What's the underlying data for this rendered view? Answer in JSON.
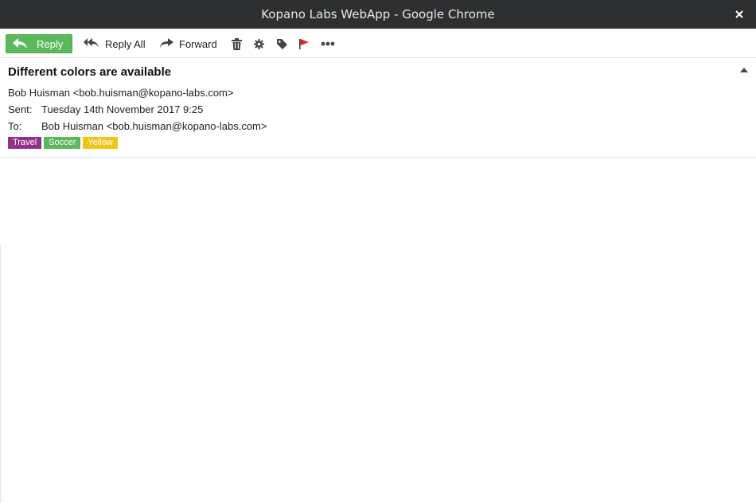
{
  "window": {
    "title": "Kopano Labs WebApp - Google Chrome"
  },
  "toolbar": {
    "reply": "Reply",
    "reply_all": "Reply All",
    "forward": "Forward",
    "icons": [
      "reply-icon",
      "reply-all-icon",
      "forward-icon",
      "trash-icon",
      "gear-icon",
      "tag-icon",
      "flag-icon",
      "more-icon"
    ]
  },
  "message": {
    "subject": "Different colors are available",
    "from": "Bob Huisman <bob.huisman@kopano-labs.com>",
    "sent_label": "Sent:",
    "sent": "Tuesday 14th November 2017 9:25",
    "to_label": "To:",
    "to": "Bob Huisman <bob.huisman@kopano-labs.com>",
    "labels": [
      {
        "text": "Travel",
        "color": "#93318c"
      },
      {
        "text": "Soccer",
        "color": "#5cb85c"
      },
      {
        "text": "Yellow",
        "color": "#f0c419"
      }
    ]
  },
  "colors": {
    "titlebar": "#2d2f31",
    "reply_button": "#5bb95b",
    "flag": "#e02424"
  }
}
